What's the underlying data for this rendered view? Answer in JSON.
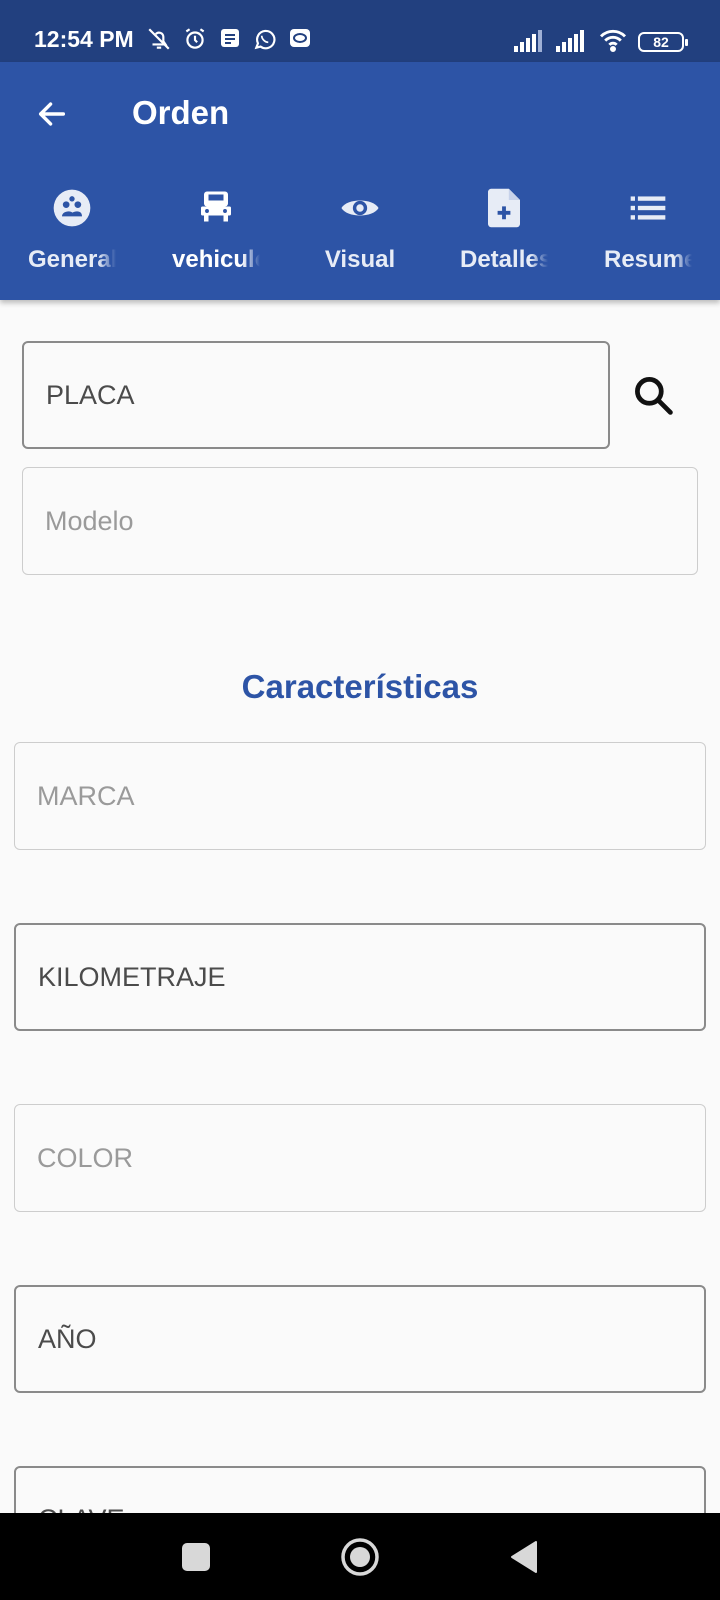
{
  "status_bar": {
    "time": "12:54 PM",
    "left_icons": [
      "bell-off-icon",
      "alarm-icon",
      "notes-icon",
      "whatsapp-icon",
      "chat-icon"
    ],
    "right_icons": [
      "signal-icon",
      "signal-icon",
      "wifi-icon"
    ],
    "battery": "82"
  },
  "app_bar": {
    "title": "Orden",
    "tabs": [
      {
        "label": "General",
        "icon": "users-icon",
        "active": false
      },
      {
        "label": "vehiculo",
        "icon": "car-icon",
        "active": true
      },
      {
        "label": "Visual",
        "icon": "eye-icon",
        "active": false
      },
      {
        "label": "Detalles",
        "icon": "add-document-icon",
        "active": false
      },
      {
        "label": "Resumen",
        "icon": "list-icon",
        "active": false
      }
    ]
  },
  "form": {
    "placa_placeholder": "PLACA",
    "modelo_placeholder": "Modelo",
    "section_title": "Características",
    "marca_placeholder": "MARCA",
    "kilometraje_placeholder": "KILOMETRAJE",
    "color_placeholder": "COLOR",
    "anio_placeholder": "AÑO",
    "clave_placeholder": "CLAVE"
  },
  "colors": {
    "status_bar": "#22407f",
    "primary": "#2d54a6",
    "background": "#fafafa",
    "nav_bar": "#000000"
  }
}
